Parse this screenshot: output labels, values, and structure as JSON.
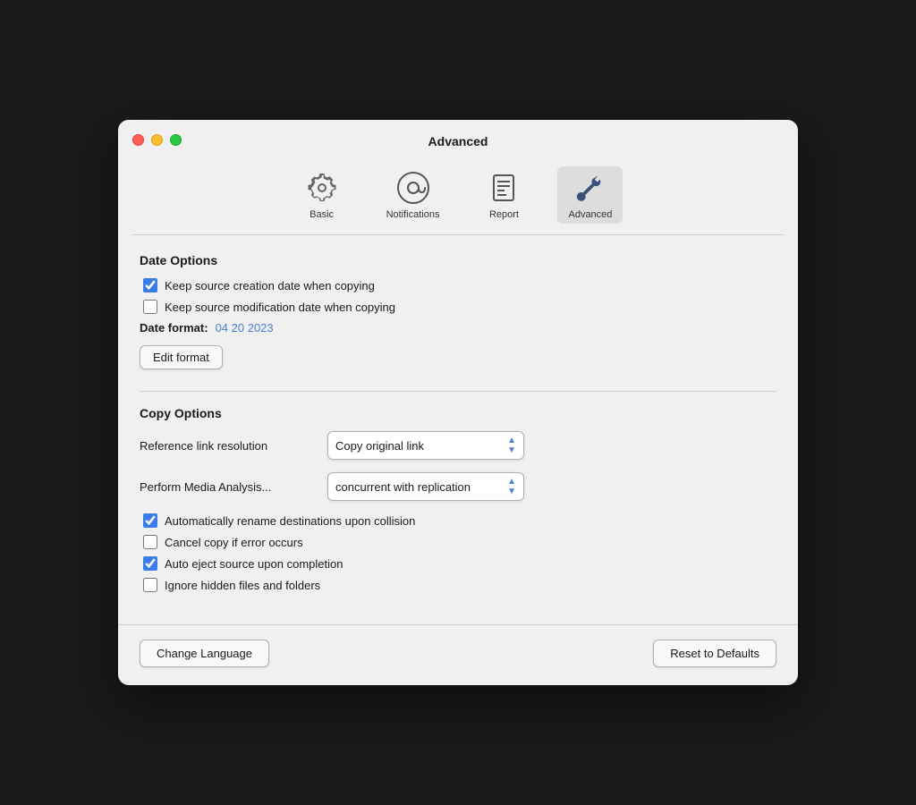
{
  "window": {
    "title": "Advanced"
  },
  "toolbar": {
    "items": [
      {
        "id": "basic",
        "label": "Basic",
        "icon": "gear"
      },
      {
        "id": "notifications",
        "label": "Notifications",
        "icon": "at"
      },
      {
        "id": "report",
        "label": "Report",
        "icon": "report"
      },
      {
        "id": "advanced",
        "label": "Advanced",
        "icon": "wrench",
        "active": true
      }
    ]
  },
  "date_options": {
    "section_title": "Date Options",
    "checkbox1_label": "Keep source creation date when copying",
    "checkbox1_checked": true,
    "checkbox2_label": "Keep source modification date when copying",
    "checkbox2_checked": false,
    "date_format_label": "Date format:",
    "date_format_value": "04 20 2023",
    "edit_format_label": "Edit format"
  },
  "copy_options": {
    "section_title": "Copy Options",
    "ref_link_label": "Reference link resolution",
    "ref_link_value": "Copy original link",
    "media_analysis_label": "Perform Media Analysis...",
    "media_analysis_value": "concurrent with replication",
    "checkbox3_label": "Automatically rename destinations upon collision",
    "checkbox3_checked": true,
    "checkbox4_label": "Cancel copy if error occurs",
    "checkbox4_checked": false,
    "checkbox5_label": "Auto eject source upon completion",
    "checkbox5_checked": true,
    "checkbox6_label": "Ignore hidden files and folders",
    "checkbox6_checked": false
  },
  "bottom": {
    "change_language_label": "Change Language",
    "reset_defaults_label": "Reset to Defaults"
  }
}
